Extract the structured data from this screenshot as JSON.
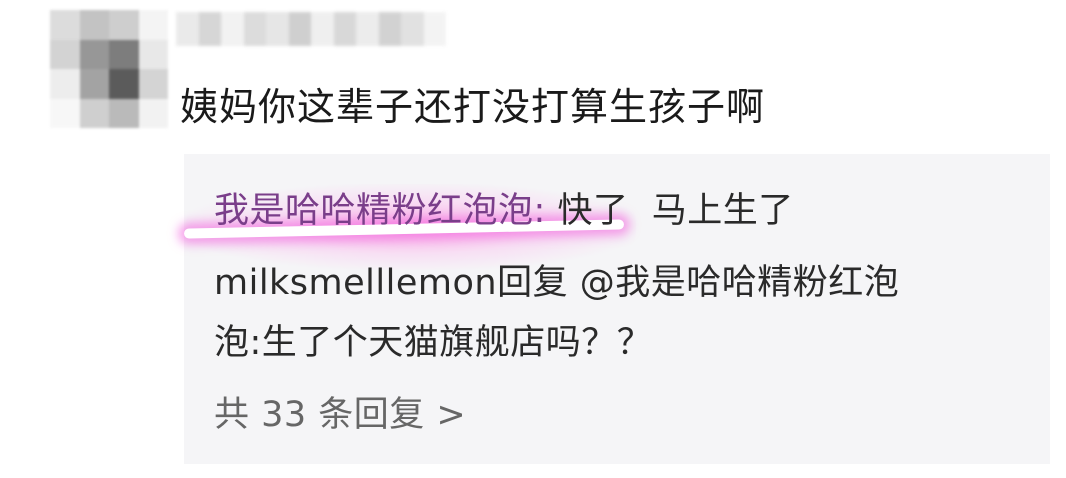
{
  "comment": {
    "text": "姨妈你这辈子还打没打算生孩子啊"
  },
  "replies": [
    {
      "author": "我是哈哈精粉红泡泡",
      "separator": ": ",
      "text": "快了  马上生了"
    },
    {
      "author": "milksmelllemon",
      "text_part1": "回复 @我是哈哈精粉红泡",
      "text_part2": "泡:生了个天猫旗舰店吗？？"
    }
  ],
  "more_replies": {
    "label": "共 33 条回复 >"
  },
  "colors": {
    "highlight": "#f05adc",
    "reply_bg": "#f5f5f7",
    "text": "#1a1a1a",
    "muted": "#666666"
  }
}
